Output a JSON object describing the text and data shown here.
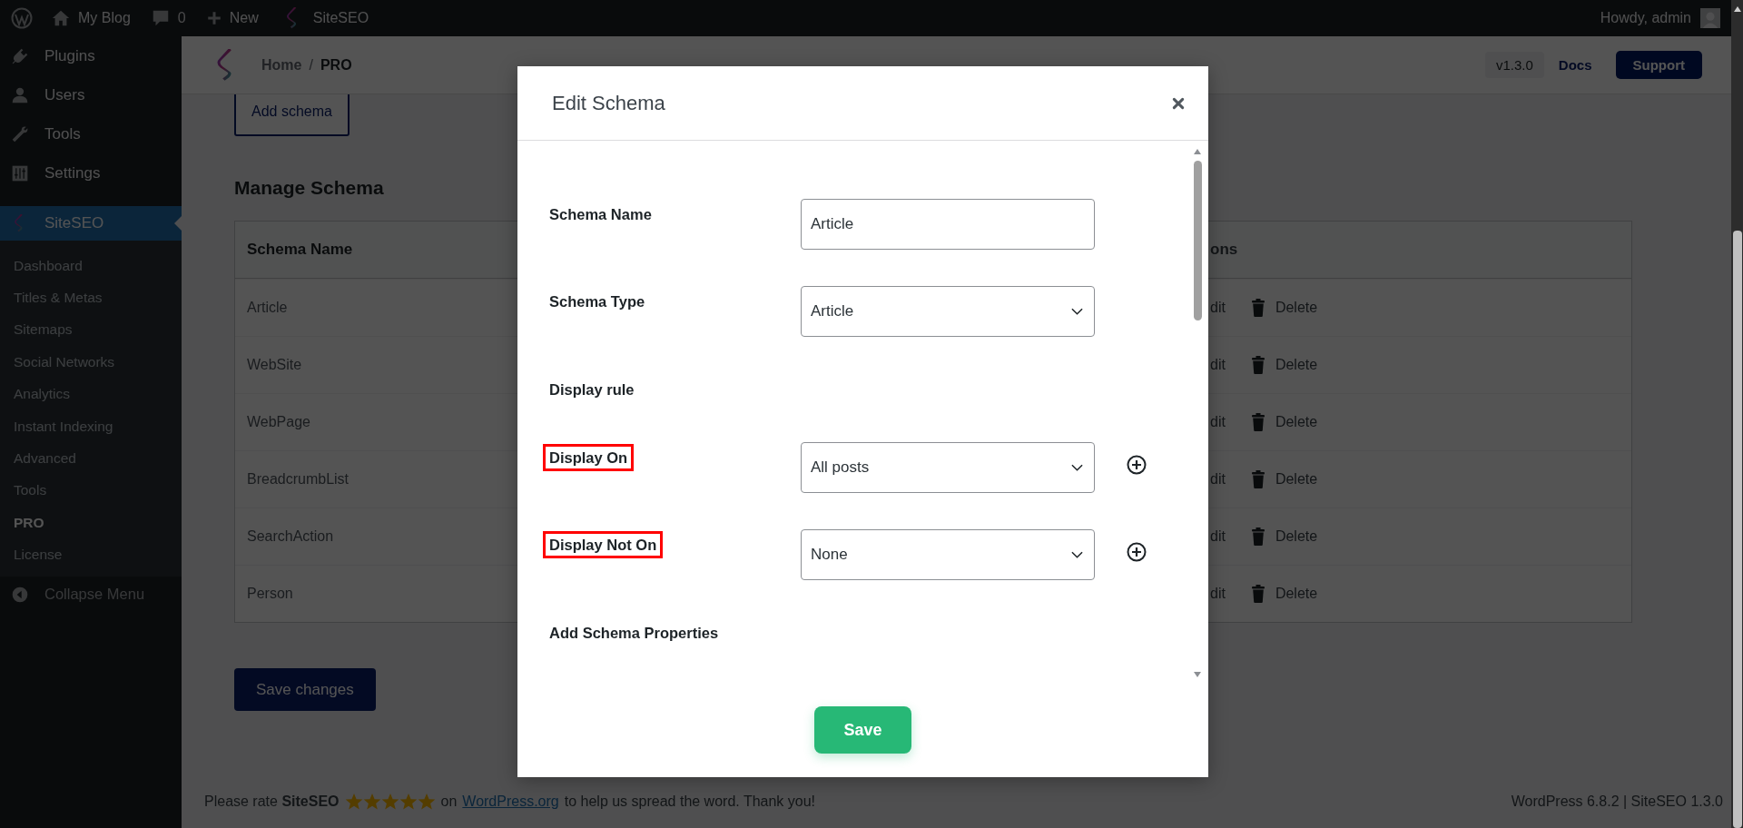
{
  "admin_bar": {
    "site": "My Blog",
    "comments": "0",
    "new": "New",
    "plugin": "SiteSEO",
    "greeting": "Howdy, admin"
  },
  "sidebar": {
    "items": [
      {
        "label": "Plugins",
        "selected": false
      },
      {
        "label": "Users",
        "selected": false
      },
      {
        "label": "Tools",
        "selected": false
      },
      {
        "label": "Settings",
        "selected": false
      },
      {
        "label": "SiteSEO",
        "selected": true
      }
    ],
    "submenu": [
      {
        "label": "Dashboard",
        "selected": false
      },
      {
        "label": "Titles & Metas",
        "selected": false
      },
      {
        "label": "Sitemaps",
        "selected": false
      },
      {
        "label": "Social Networks",
        "selected": false
      },
      {
        "label": "Analytics",
        "selected": false
      },
      {
        "label": "Instant Indexing",
        "selected": false
      },
      {
        "label": "Advanced",
        "selected": false
      },
      {
        "label": "Tools",
        "selected": false
      },
      {
        "label": "PRO",
        "selected": true
      },
      {
        "label": "License",
        "selected": false
      }
    ],
    "collapse": "Collapse Menu"
  },
  "header": {
    "breadcrumb": [
      "Home",
      "PRO"
    ],
    "separator": "/",
    "version": "v1.3.0",
    "docs": "Docs",
    "support": "Support"
  },
  "add_button": "Add schema",
  "section_title": "Manage Schema",
  "table": {
    "columns": [
      "Schema Name",
      "ons"
    ],
    "rows": [
      {
        "name": "Article",
        "edit": "dit",
        "delete": "Delete"
      },
      {
        "name": "WebSite",
        "edit": "dit",
        "delete": "Delete"
      },
      {
        "name": "WebPage",
        "edit": "dit",
        "delete": "Delete"
      },
      {
        "name": "BreadcrumbList",
        "edit": "dit",
        "delete": "Delete"
      },
      {
        "name": "SearchAction",
        "edit": "dit",
        "delete": "Delete"
      },
      {
        "name": "Person",
        "edit": "dit",
        "delete": "Delete"
      }
    ]
  },
  "save_changes": "Save changes",
  "footer": {
    "rate": "Please rate **SiteSEO**",
    "stars": 5,
    "after_stars": "on",
    "link": "WordPress.org",
    "rest": "to help us spread the word. Thank you!",
    "version": "WordPress 6.8.2 | SiteSEO 1.3.0"
  },
  "modal": {
    "title": "Edit Schema",
    "fields": [
      {
        "kind": "text",
        "label": "Schema Name",
        "value": "Article",
        "highlighted": false
      },
      {
        "kind": "select",
        "label": "Schema Type",
        "value": "Article",
        "highlighted": false
      },
      {
        "kind": "heading",
        "label": "Display rule",
        "highlighted": false
      },
      {
        "kind": "select",
        "label": "Display On",
        "value": "All posts",
        "highlighted": true,
        "addable": true
      },
      {
        "kind": "select",
        "label": "Display Not On",
        "value": "None",
        "highlighted": true,
        "addable": true
      },
      {
        "kind": "heading",
        "label": "Add Schema Properties",
        "highlighted": false
      }
    ],
    "save": "Save"
  }
}
